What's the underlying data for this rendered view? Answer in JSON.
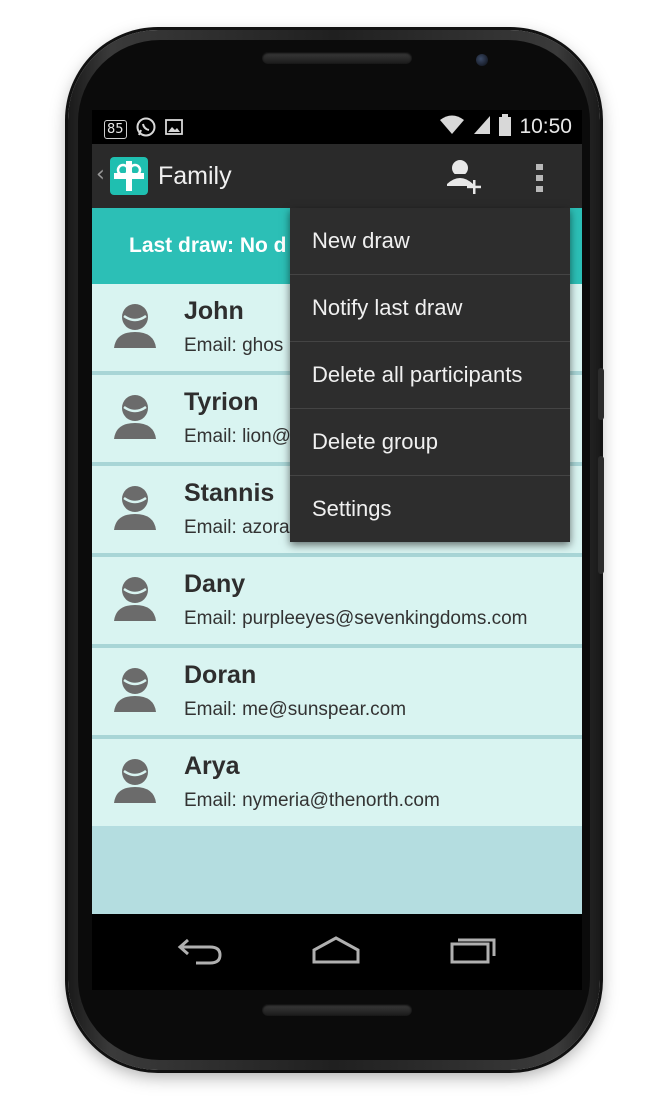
{
  "statusbar": {
    "notification_badge": "85",
    "time": "10:50",
    "icons": [
      "whatsapp-icon",
      "image-icon",
      "wifi-icon",
      "signal-icon",
      "battery-icon"
    ]
  },
  "actionbar": {
    "back_glyph": "‹",
    "title": "Family",
    "icons": [
      "app-gift-icon",
      "add-person-icon",
      "overflow-menu-icon"
    ]
  },
  "banner": {
    "text": "Last draw: No d"
  },
  "participants": [
    {
      "name": "John",
      "email": "Email: ghos"
    },
    {
      "name": "Tyrion",
      "email": "Email: lion@"
    },
    {
      "name": "Stannis",
      "email": "Email: azora"
    },
    {
      "name": "Dany",
      "email": "Email: purpleeyes@sevenkingdoms.com"
    },
    {
      "name": "Doran",
      "email": "Email: me@sunspear.com"
    },
    {
      "name": "Arya",
      "email": "Email: nymeria@thenorth.com"
    }
  ],
  "overflow_menu": {
    "items": [
      "New draw",
      "Notify last draw",
      "Delete all participants",
      "Delete group",
      "Settings"
    ]
  },
  "navbar": {
    "icons": [
      "back-icon",
      "home-icon",
      "recents-icon"
    ]
  },
  "colors": {
    "accent": "#2cbfb6",
    "row_bg": "#d9f4f1",
    "list_bg": "#b4dde0",
    "menu_bg": "#2d2d2d"
  }
}
